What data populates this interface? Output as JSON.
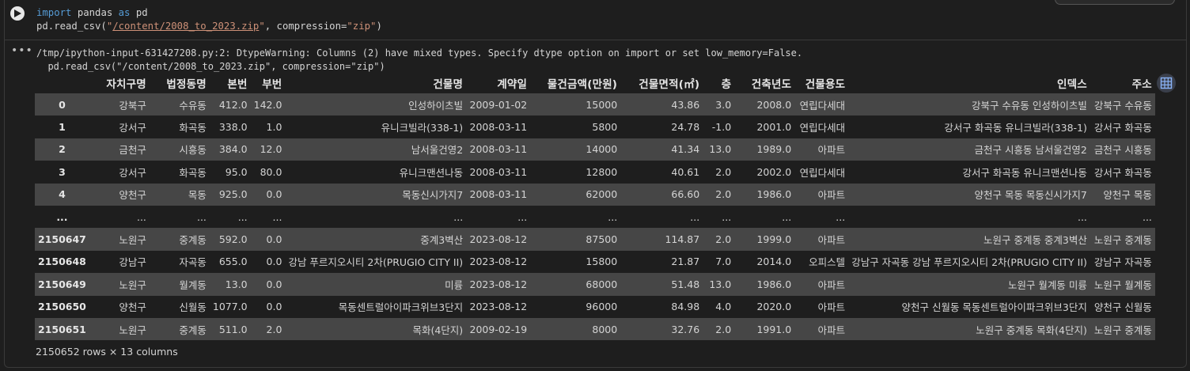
{
  "code": {
    "line1": {
      "kw1": "import",
      "mid": " pandas ",
      "kw2": "as",
      "end": " pd"
    },
    "line2": {
      "pre": "pd.read_csv(",
      "q1": "\"",
      "path": "/content/2008_to_2023.zip",
      "q2": "\"",
      "mid": ", compression=",
      "comp": "\"zip\"",
      "end": ")"
    }
  },
  "output": {
    "warning_line1": "/tmp/ipython-input-631427208.py:2: DtypeWarning: Columns (2) have mixed types. Specify dtype option on import or set low_memory=False.",
    "warning_line2": "  pd.read_csv(\"/content/2008_to_2023.zip\", compression=\"zip\")"
  },
  "table": {
    "columns": [
      "",
      "자치구명",
      "법정동명",
      "본번",
      "부번",
      "건물명",
      "계약일",
      "물건금액(만원)",
      "건물면적(㎡)",
      "층",
      "건축년도",
      "건물용도",
      "인덱스",
      "주소"
    ],
    "rows": [
      [
        "0",
        "강북구",
        "수유동",
        "412.0",
        "142.0",
        "인성하이츠빌",
        "2009-01-02",
        "15000",
        "43.86",
        "3.0",
        "2008.0",
        "연립다세대",
        "강북구 수유동 인성하이츠빌",
        "강북구 수유동"
      ],
      [
        "1",
        "강서구",
        "화곡동",
        "338.0",
        "1.0",
        "유니크빌라(338-1)",
        "2008-03-11",
        "5800",
        "24.78",
        "-1.0",
        "2001.0",
        "연립다세대",
        "강서구 화곡동 유니크빌라(338-1)",
        "강서구 화곡동"
      ],
      [
        "2",
        "금천구",
        "시흥동",
        "384.0",
        "12.0",
        "남서울건영2",
        "2008-03-11",
        "14000",
        "41.34",
        "13.0",
        "1989.0",
        "아파트",
        "금천구 시흥동 남서울건영2",
        "금천구 시흥동"
      ],
      [
        "3",
        "강서구",
        "화곡동",
        "95.0",
        "80.0",
        "유니크맨션나동",
        "2008-03-11",
        "12800",
        "40.61",
        "2.0",
        "2002.0",
        "연립다세대",
        "강서구 화곡동 유니크맨션나동",
        "강서구 화곡동"
      ],
      [
        "4",
        "양천구",
        "목동",
        "925.0",
        "0.0",
        "목동신시가지7",
        "2008-03-11",
        "62000",
        "66.60",
        "2.0",
        "1986.0",
        "아파트",
        "양천구 목동 목동신시가지7",
        "양천구 목동"
      ],
      [
        "...",
        "...",
        "...",
        "...",
        "...",
        "...",
        "...",
        "...",
        "...",
        "...",
        "...",
        "...",
        "...",
        "..."
      ],
      [
        "2150647",
        "노원구",
        "중계동",
        "592.0",
        "0.0",
        "중계3벽산",
        "2023-08-12",
        "87500",
        "114.87",
        "2.0",
        "1999.0",
        "아파트",
        "노원구 중계동 중계3벽산",
        "노원구 중계동"
      ],
      [
        "2150648",
        "강남구",
        "자곡동",
        "655.0",
        "0.0",
        "강남 푸르지오시티 2차(PRUGIO CITY II)",
        "2023-08-12",
        "15800",
        "21.87",
        "7.0",
        "2014.0",
        "오피스텔",
        "강남구 자곡동 강남 푸르지오시티 2차(PRUGIO CITY II)",
        "강남구 자곡동"
      ],
      [
        "2150649",
        "노원구",
        "월계동",
        "13.0",
        "0.0",
        "미륭",
        "2023-08-12",
        "68000",
        "51.48",
        "13.0",
        "1986.0",
        "아파트",
        "노원구 월계동 미륭",
        "노원구 월계동"
      ],
      [
        "2150650",
        "양천구",
        "신월동",
        "1077.0",
        "0.0",
        "목동센트럴아이파크위브3단지",
        "2023-08-12",
        "96000",
        "84.98",
        "4.0",
        "2020.0",
        "아파트",
        "양천구 신월동 목동센트럴아이파크위브3단지",
        "양천구 신월동"
      ],
      [
        "2150651",
        "노원구",
        "중계동",
        "511.0",
        "2.0",
        "목화(4단지)",
        "2009-02-19",
        "8000",
        "32.76",
        "2.0",
        "1991.0",
        "아파트",
        "노원구 중계동 목화(4단지)",
        "노원구 중계동"
      ]
    ],
    "footer": "2150652 rows × 13 columns"
  },
  "icons": {
    "run": "play-icon",
    "output_menu": "more-horizontal-icon",
    "table_view": "table-grid-icon"
  },
  "colors": {
    "background": "#1e1e1e",
    "row_odd": "#464646",
    "keyword": "#569cd6",
    "string": "#ce9178"
  }
}
